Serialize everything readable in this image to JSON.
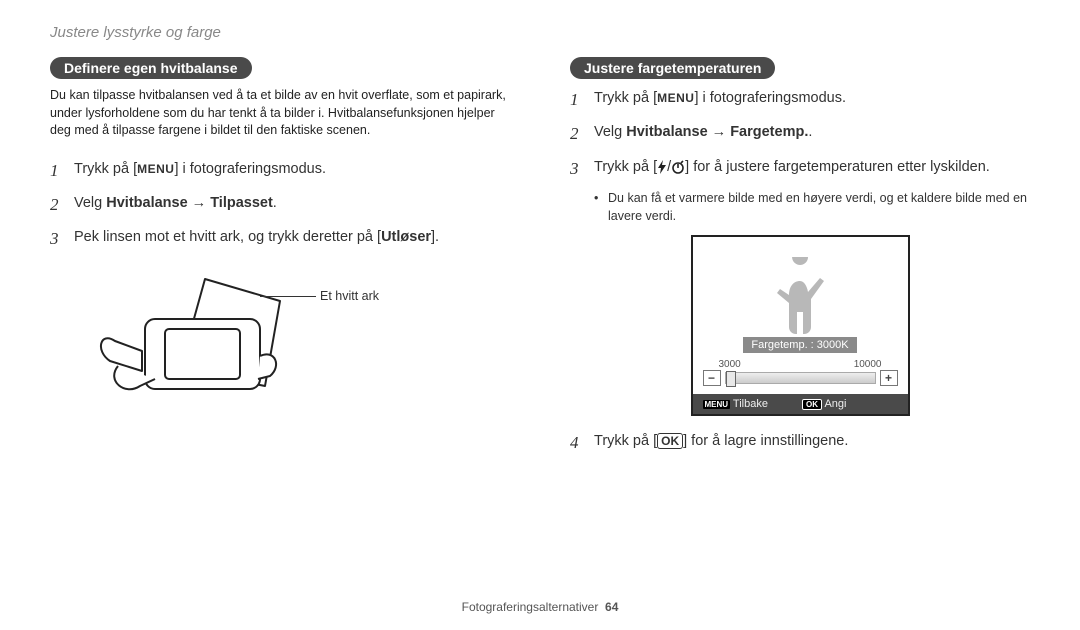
{
  "page_title": "Justere lysstyrke og farge",
  "footer": {
    "text": "Fotograferingsalternativer",
    "page": "64"
  },
  "left": {
    "heading": "Definere egen hvitbalanse",
    "intro": "Du kan tilpasse hvitbalansen ved å ta et bilde av en hvit overflate, som et papirark, under lysforholdene som du har tenkt å ta bilder i. Hvitbalansefunksjonen hjelper deg med å tilpasse fargene i bildet til den faktiske scenen.",
    "steps": [
      {
        "n": "1",
        "pre": "Trykk på [",
        "icon": "MENU",
        "post": "] i fotograferingsmodus."
      },
      {
        "n": "2",
        "plain": "Velg ",
        "bold": "Hvitbalanse → Tilpasset",
        "end": "."
      },
      {
        "n": "3",
        "plain": "Pek linsen mot et hvitt ark, og trykk deretter på [",
        "bold": "Utløser",
        "end": "]."
      }
    ],
    "figure_label": "Et hvitt ark"
  },
  "right": {
    "heading": "Justere fargetemperaturen",
    "steps": [
      {
        "n": "1",
        "pre": "Trykk på [",
        "icon": "MENU",
        "post": "] i fotograferingsmodus."
      },
      {
        "n": "2",
        "plain": "Velg ",
        "bold": "Hvitbalanse → Fargetemp.",
        "end": "."
      },
      {
        "n": "3",
        "pre": "Trykk på [",
        "icons": "flash/timer",
        "post": "] for å justere fargetemperaturen etter lyskilden."
      }
    ],
    "bullet": "Du kan få et varmere bilde med en høyere verdi, og et kaldere bilde med en lavere verdi.",
    "screen": {
      "label": "Fargetemp. : 3000K",
      "min": "3000",
      "max": "10000",
      "minus": "−",
      "plus": "+",
      "back_icon": "MENU",
      "back": "Tilbake",
      "set_icon": "OK",
      "set": "Angi"
    },
    "step4": {
      "n": "4",
      "pre": "Trykk på [",
      "icon": "OK",
      "post": "] for å lagre innstillingene."
    }
  }
}
